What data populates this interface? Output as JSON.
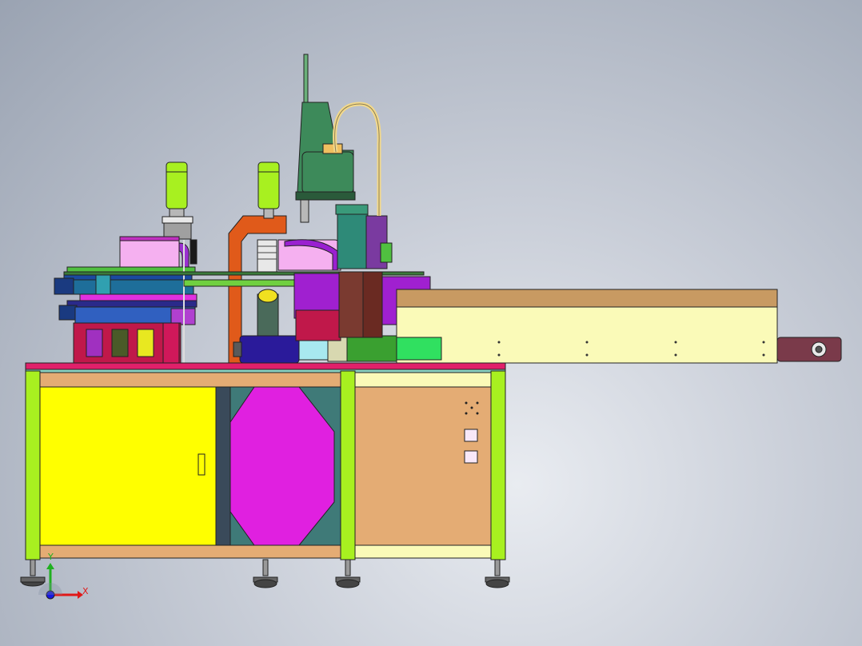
{
  "viewport": {
    "background_top": "#8e98a8",
    "background_bottom": "#eef0f3"
  },
  "machine": {
    "frame_color": "#a8f020",
    "cabinet_left_door_color": "#ffff00",
    "cabinet_middle_panel_color": "#e020e0",
    "cabinet_middle_bg_color": "#3f7a78",
    "cabinet_right_door_color": "#e4ac74",
    "cabinet_rail_color": "#e4ac74",
    "top_plate_color": "#e0206a",
    "conveyor_body_color": "#fafab8",
    "conveyor_top_color": "#c89a62",
    "robot_color": "#3d8a5a",
    "cylinder_color": "#a8f020",
    "bracket_color": "#e05a1a",
    "motor_color": "#2a1a9a",
    "vacuum_color": "#a8e8f0",
    "magenta_tray_color": "#f5b0f0",
    "purple_block_color": "#a020d0",
    "red_block_color": "#c0184a"
  },
  "axes_triad": {
    "x_label": "X",
    "y_label": "Y",
    "x_color": "#e01818",
    "y_color": "#20b020",
    "z_color": "#1818e0"
  }
}
